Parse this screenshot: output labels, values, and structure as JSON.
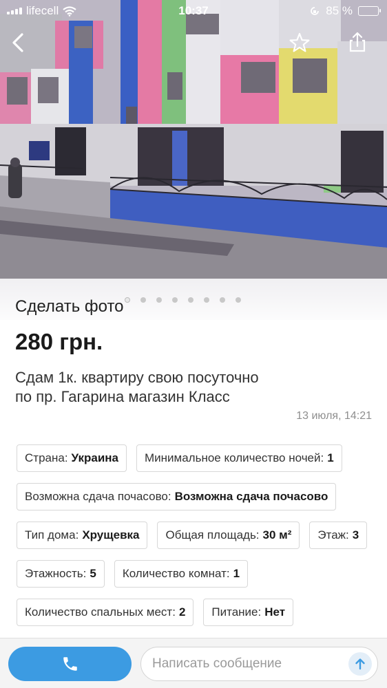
{
  "status_bar": {
    "carrier": "lifecell",
    "time": "10:37",
    "battery": "85 %"
  },
  "gallery": {
    "take_photo_label": "Сделать фото",
    "dot_count": 8,
    "active_index": 0
  },
  "listing": {
    "price": "280 грн.",
    "title": "Сдам 1к. квартиру свою посуточно по пр. Гагарина магазин Класс",
    "date": "13 июля, 14:21",
    "params": [
      {
        "label": "Страна:",
        "value": "Украина"
      },
      {
        "label": "Минимальное количество ночей:",
        "value": "1"
      },
      {
        "label": "Возможна сдача почасово:",
        "value": "Возможна сдача почасово"
      },
      {
        "label": "Тип дома:",
        "value": "Хрущевка"
      },
      {
        "label": "Общая площадь:",
        "value": "30 м²"
      },
      {
        "label": "Этаж:",
        "value": "3"
      },
      {
        "label": "Этажность:",
        "value": "5"
      },
      {
        "label": "Количество комнат:",
        "value": "1"
      },
      {
        "label": "Количество спальных мест:",
        "value": "2"
      },
      {
        "label": "Питание:",
        "value": "Нет"
      }
    ]
  },
  "bottom_bar": {
    "message_placeholder": "Написать сообщение"
  },
  "colors": {
    "accent": "#3c9be2",
    "chip_border": "#d7d7d7",
    "muted_text": "#8e8e8e"
  },
  "icons": [
    "signal-icon",
    "wifi-icon",
    "rotation-lock-icon",
    "battery-icon",
    "back-icon",
    "star-icon",
    "share-icon",
    "phone-icon",
    "send-arrow-icon"
  ]
}
